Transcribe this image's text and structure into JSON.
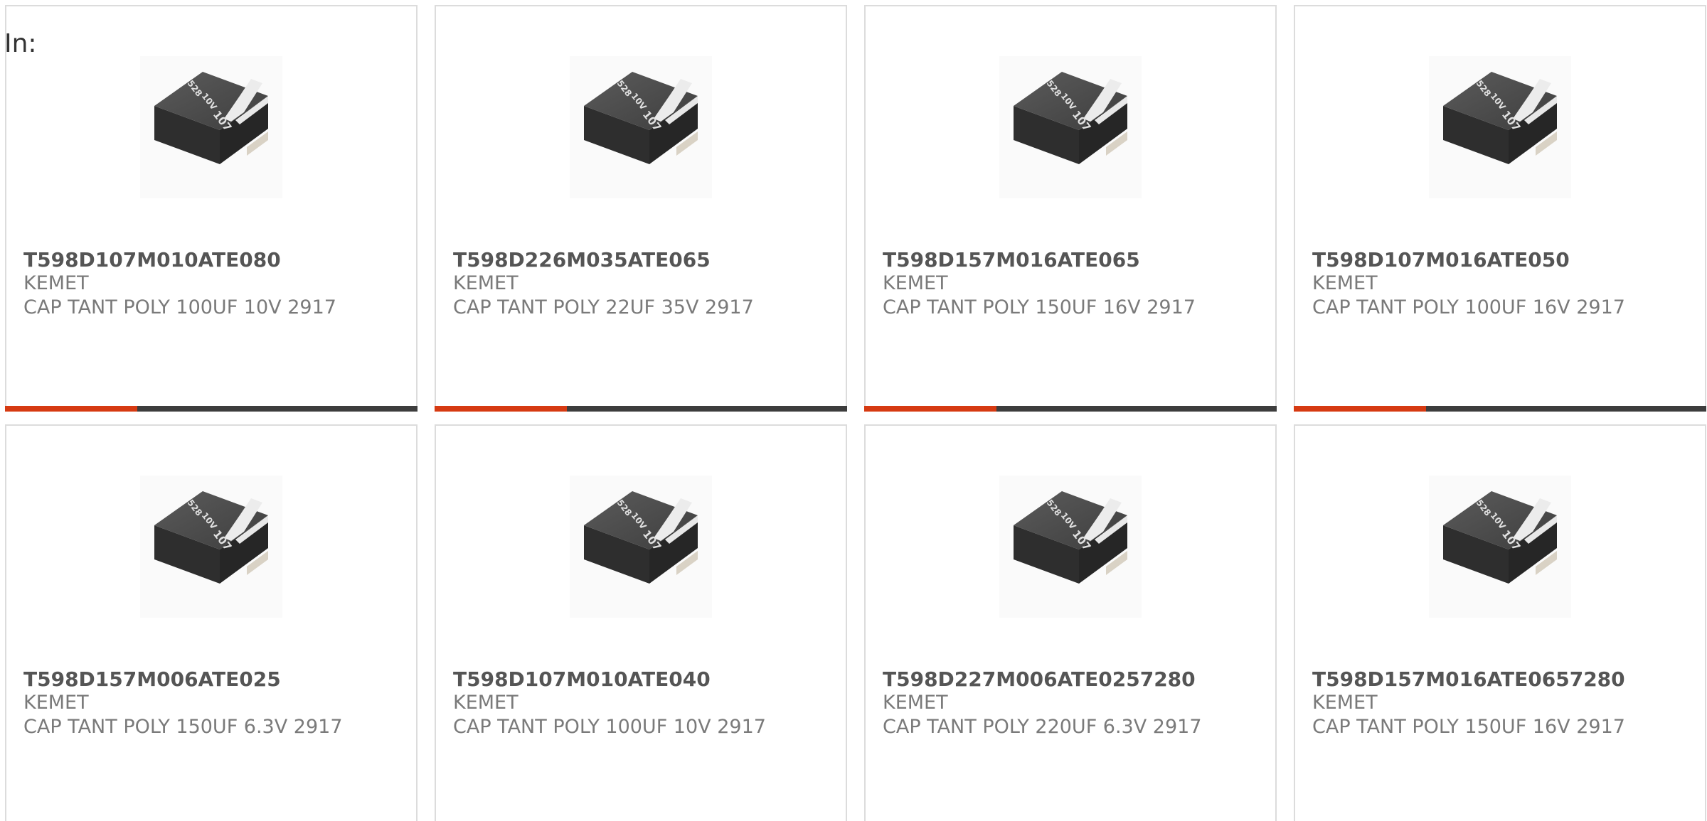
{
  "header": {
    "in_label": "In:"
  },
  "colors": {
    "accent": "#d63a12",
    "bar_track": "#3d3d3d",
    "border": "#dcdcdc",
    "title": "#555555",
    "subtitle": "#7a7a7a"
  },
  "products": [
    {
      "part_number": "T598D107M010ATE080",
      "manufacturer": "KEMET",
      "description": "CAP TANT POLY 100UF 10V 2917",
      "image_icon": "tantalum-capacitor-image",
      "chip_marking": [
        "107",
        "10V",
        "528"
      ],
      "progress": 0.32
    },
    {
      "part_number": "T598D226M035ATE065",
      "manufacturer": "KEMET",
      "description": "CAP TANT POLY 22UF 35V 2917",
      "image_icon": "tantalum-capacitor-image",
      "chip_marking": [
        "107",
        "10V",
        "528"
      ],
      "progress": 0.32
    },
    {
      "part_number": "T598D157M016ATE065",
      "manufacturer": "KEMET",
      "description": "CAP TANT POLY 150UF 16V 2917",
      "image_icon": "tantalum-capacitor-image",
      "chip_marking": [
        "107",
        "10V",
        "528"
      ],
      "progress": 0.32
    },
    {
      "part_number": "T598D107M016ATE050",
      "manufacturer": "KEMET",
      "description": "CAP TANT POLY 100UF 16V 2917",
      "image_icon": "tantalum-capacitor-image",
      "chip_marking": [
        "107",
        "10V",
        "528"
      ],
      "progress": 0.32
    },
    {
      "part_number": "T598D157M006ATE025",
      "manufacturer": "KEMET",
      "description": "CAP TANT POLY 150UF 6.3V 2917",
      "image_icon": "tantalum-capacitor-image",
      "chip_marking": [
        "107",
        "10V",
        "528"
      ],
      "progress": null
    },
    {
      "part_number": "T598D107M010ATE040",
      "manufacturer": "KEMET",
      "description": "CAP TANT POLY 100UF 10V 2917",
      "image_icon": "tantalum-capacitor-image",
      "chip_marking": [
        "107",
        "10V",
        "528"
      ],
      "progress": null
    },
    {
      "part_number": "T598D227M006ATE0257280",
      "manufacturer": "KEMET",
      "description": "CAP TANT POLY 220UF 6.3V 2917",
      "image_icon": "tantalum-capacitor-image",
      "chip_marking": [
        "107",
        "10V",
        "528"
      ],
      "progress": null
    },
    {
      "part_number": "T598D157M016ATE0657280",
      "manufacturer": "KEMET",
      "description": "CAP TANT POLY 150UF 16V 2917",
      "image_icon": "tantalum-capacitor-image",
      "chip_marking": [
        "107",
        "10V",
        "528"
      ],
      "progress": null
    }
  ]
}
